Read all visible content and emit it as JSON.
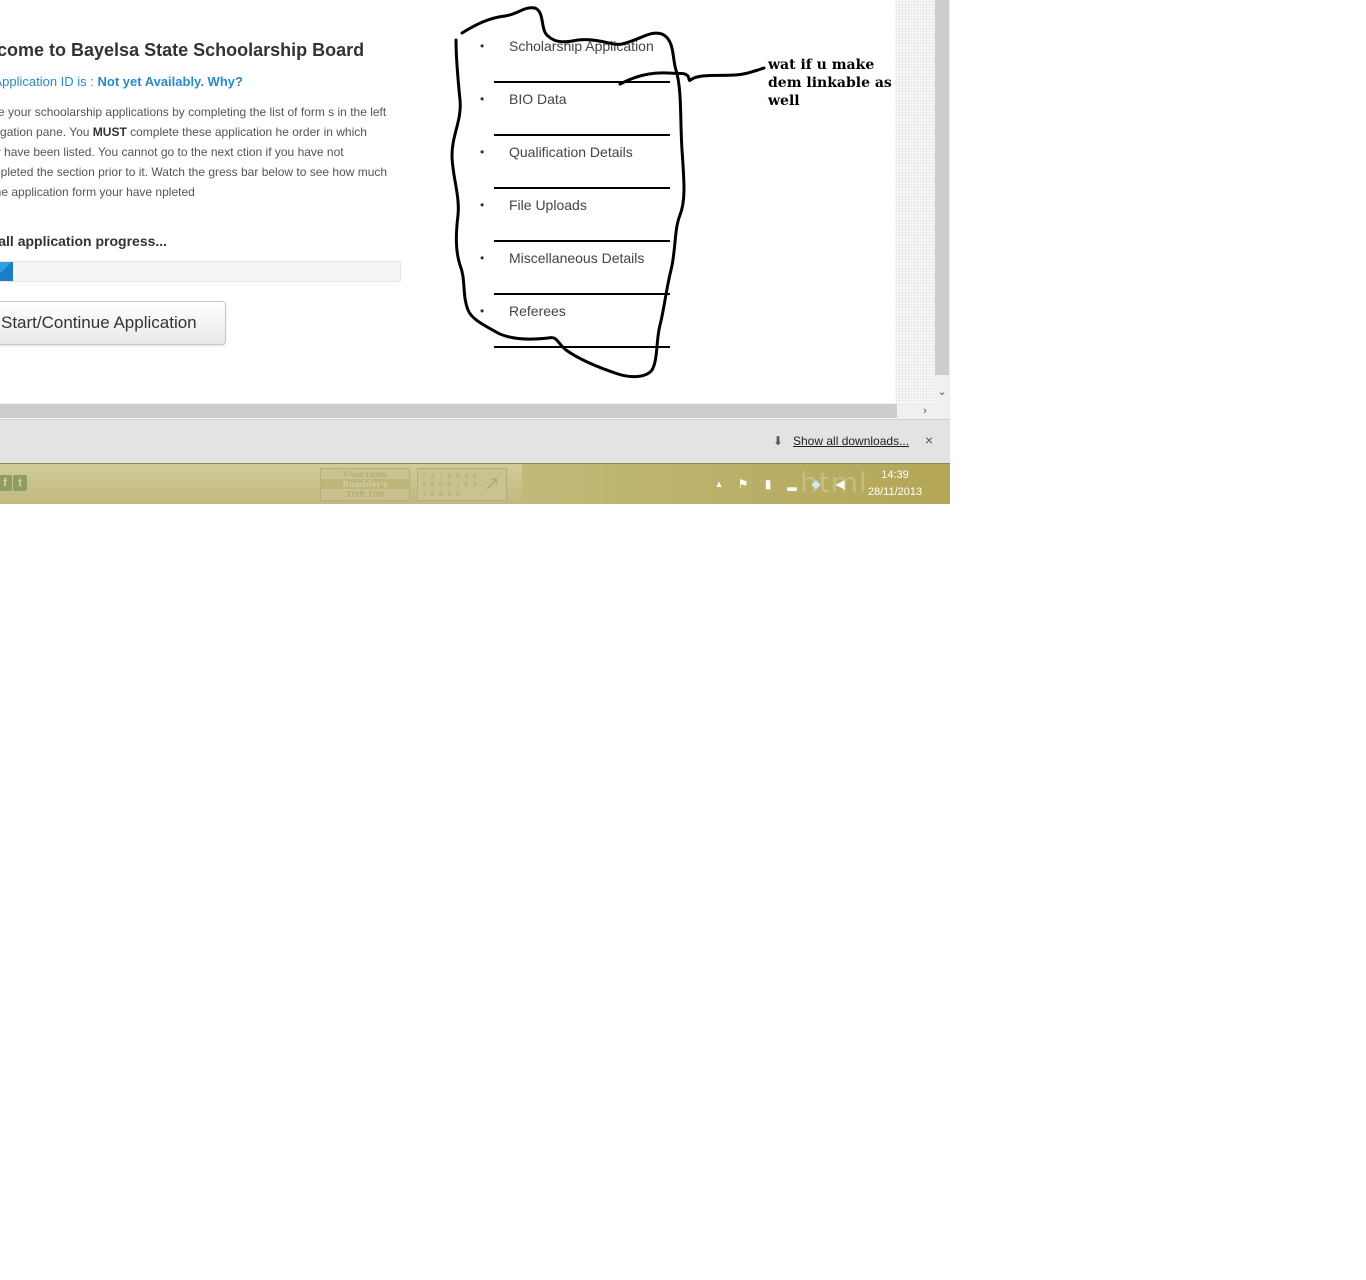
{
  "content": {
    "welcome_title": "elcome to Bayelsa State Schoolarship Board",
    "app_id_prefix": "ur Application ID is : ",
    "app_id_status": "Not yet Availably. Why?",
    "intro_part1": "nage your schoolarship applications by completing the list of form s in the left navigation pane. You ",
    "intro_bold": "MUST",
    "intro_part2": " complete these application he order in which they have been listed. You cannot go to the next ction if you have not completed the section prior to it. Watch the gress bar below to see how much of the application form your have npleted",
    "progress_title": "erall application progress...",
    "progress_fraction": 0.055,
    "start_button": "Start/Continue Application"
  },
  "nav": {
    "items": [
      {
        "label": "Scholarship Application"
      },
      {
        "label": "BIO Data"
      },
      {
        "label": "Qualification Details"
      },
      {
        "label": "File Uploads"
      },
      {
        "label": "Miscellaneous Details"
      },
      {
        "label": "Referees"
      }
    ]
  },
  "annotation": {
    "text": "wat if u make dem linkable as well"
  },
  "downloads_bar": {
    "show_all": "Show all downloads...",
    "close": "×"
  },
  "taskbar": {
    "rambler_line1": "Участник",
    "rambler_line2": "Rambler's",
    "rambler_line3": "TOP 100",
    "counter_digits": "7 3 7 6  6 4 0  0 0 0  0 1 6  3 3 0  0 8 0",
    "watermark": "html",
    "time": "14:39",
    "date": "28/11/2013"
  },
  "icons": {
    "facebook": "facebook-icon",
    "twitter": "twitter-icon",
    "tray": [
      "tray-arrow-up-icon",
      "flag-icon",
      "battery-icon",
      "signal-icon",
      "dropbox-icon",
      "volume-icon"
    ]
  }
}
